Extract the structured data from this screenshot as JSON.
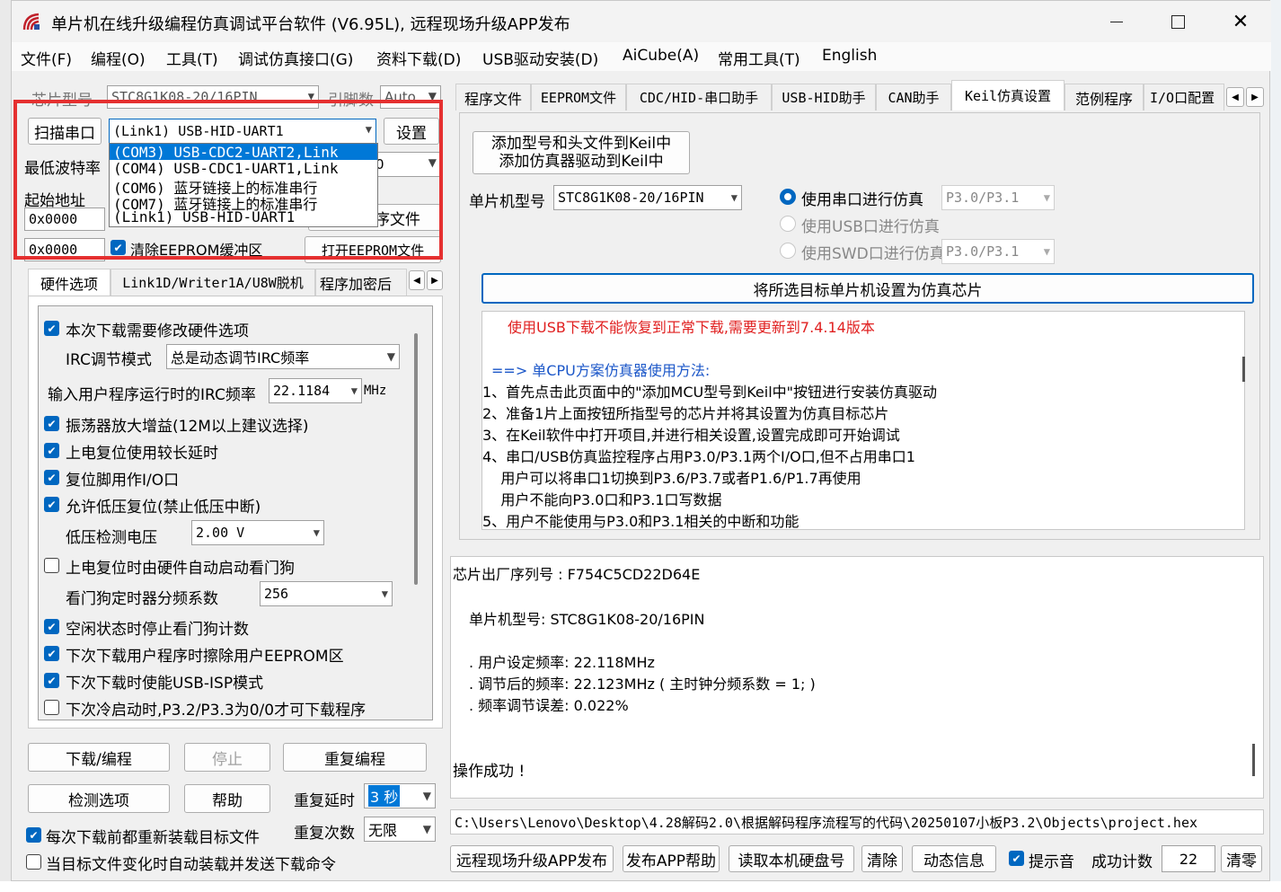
{
  "window": {
    "title": "单片机在线升级编程仿真调试平台软件 (V6.95L), 远程现场升级APP发布",
    "min_icon": "minimize-icon",
    "max_icon": "maximize-icon",
    "close_icon": "close-icon"
  },
  "menu": [
    "文件(F)",
    "编程(O)",
    "工具(T)",
    "调试仿真接口(G)",
    "资料下载(D)",
    "USB驱动安装(D)",
    "AiCube(A)",
    "常用工具(T)",
    "English"
  ],
  "left": {
    "chip_label": "芯片型号",
    "chip_value": "STC8G1K08-20/16PIN",
    "pins_label": "引脚数",
    "pins_value": "Auto",
    "scan_button": "扫描串口",
    "port_value": "(Link1) USB-HID-UART1",
    "settings_button": "设置",
    "port_options": [
      "(COM3) USB-CDC2-UART2,Link",
      "(COM4) USB-CDC1-UART1,Link",
      "(COM6) 蓝牙链接上的标准串行",
      "(COM7) 蓝牙链接上的标准串行",
      "(Link1) USB-HID-UART1"
    ],
    "baud_label": "最低波特率",
    "baud_fragment": "0",
    "start_addr_label": "起始地址",
    "addr1": "0x0000",
    "open_prog_fragment": "序文件",
    "addr2": "0x0000",
    "clear_eeprom": "清除EEPROM缓冲区",
    "open_eeprom_button": "打开EEPROM文件",
    "tabs": [
      "硬件选项",
      "Link1D/Writer1A/U8W脱机",
      "程序加密后"
    ],
    "hw": {
      "modify_hw": "本次下载需要修改硬件选项",
      "irc_mode_label": "IRC调节模式",
      "irc_mode_value": "总是动态调节IRC频率",
      "irc_freq_label": "输入用户程序运行时的IRC频率",
      "irc_freq_value": "22.1184",
      "irc_freq_unit": "MHz",
      "osc_gain": "振荡器放大增益(12M以上建议选择)",
      "long_reset": "上电复位使用较长延时",
      "reset_io": "复位脚用作I/O口",
      "lvd_reset": "允许低压复位(禁止低压中断)",
      "lvd_label": "低压检测电压",
      "lvd_value": "2.00 V",
      "wdt_auto": "上电复位时由硬件自动启动看门狗",
      "wdt_div_label": "看门狗定时器分频系数",
      "wdt_div_value": "256",
      "idle_wdt": "空闲状态时停止看门狗计数",
      "erase_eeprom": "下次下载用户程序时擦除用户EEPROM区",
      "usb_isp": "下次下载时使能USB-ISP模式",
      "cold_start": "下次冷启动时,P3.2/P3.3为0/0才可下载程序"
    },
    "download_button": "下载/编程",
    "stop_button": "停止",
    "reprogram_button": "重复编程",
    "check_button": "检测选项",
    "help_button": "帮助",
    "repeat_delay_label": "重复延时",
    "repeat_delay_value": "3 秒",
    "repeat_count_label": "重复次数",
    "repeat_count_value": "无限",
    "reload_before": "每次下载前都重新装载目标文件",
    "auto_reload": "当目标文件变化时自动装载并发送下载命令"
  },
  "right": {
    "tabs": [
      "程序文件",
      "EEPROM文件",
      "CDC/HID-串口助手",
      "USB-HID助手",
      "CAN助手",
      "Keil仿真设置",
      "范例程序",
      "I/O口配置"
    ],
    "add_keil_line1": "添加型号和头文件到Keil中",
    "add_keil_line2": "添加仿真器驱动到Keil中",
    "mcu_label": "单片机型号",
    "mcu_value": "STC8G1K08-20/16PIN",
    "radio_serial": "使用串口进行仿真",
    "radio_serial_port": "P3.0/P3.1",
    "radio_usb": "使用USB口进行仿真",
    "radio_swd": "使用SWD口进行仿真",
    "radio_swd_port": "P3.0/P3.1",
    "set_target_button": "将所选目标单片机设置为仿真芯片",
    "info_warning": "使用USB下载不能恢复到正常下载,需要更新到7.4.14版本",
    "info_heading": "==> 单CPU方案仿真器使用方法:",
    "info_lines": [
      "1、首先点击此页面中的\"添加MCU型号到Keil中\"按钮进行安装仿真驱动",
      "2、准备1片上面按钮所指型号的芯片并将其设置为仿真目标芯片",
      "3、在Keil软件中打开项目,并进行相关设置,设置完成即可开始调试",
      "4、串口/USB仿真监控程序占用P3.0/P3.1两个I/O口,但不占用串口1",
      "    用户可以将串口1切换到P3.6/P3.7或者P1.6/P1.7再使用",
      "    用户不能向P3.0口和P3.1口写数据",
      "5、用户不能使用与P3.0和P3.1相关的中断和功能"
    ],
    "log": {
      "serial": "芯片出厂序列号 : F754C5CD22D64E",
      "mcu": "单片机型号: STC8G1K08-20/16PIN",
      "user_freq": ". 用户设定频率: 22.118MHz",
      "adj_freq": ". 调节后的频率: 22.123MHz ( 主时钟分频系数 = 1; )",
      "error": ". 频率调节误差: 0.022%",
      "success": "操作成功 !"
    },
    "path": "C:\\Users\\Lenovo\\Desktop\\4.28解码2.0\\根据解码程序流程写的代码\\20250107小板P3.2\\Objects\\project.hex",
    "bottom_buttons": [
      "远程现场升级APP发布",
      "发布APP帮助",
      "读取本机硬盘号",
      "清除",
      "动态信息"
    ],
    "sound_label": "提示音",
    "count_label": "成功计数",
    "count_value": "22",
    "zero_button": "清零"
  },
  "colors": {
    "accent": "#0067c0",
    "highlight": "#e53030",
    "warning": "#e02020",
    "info_blue": "#1a56c8"
  }
}
